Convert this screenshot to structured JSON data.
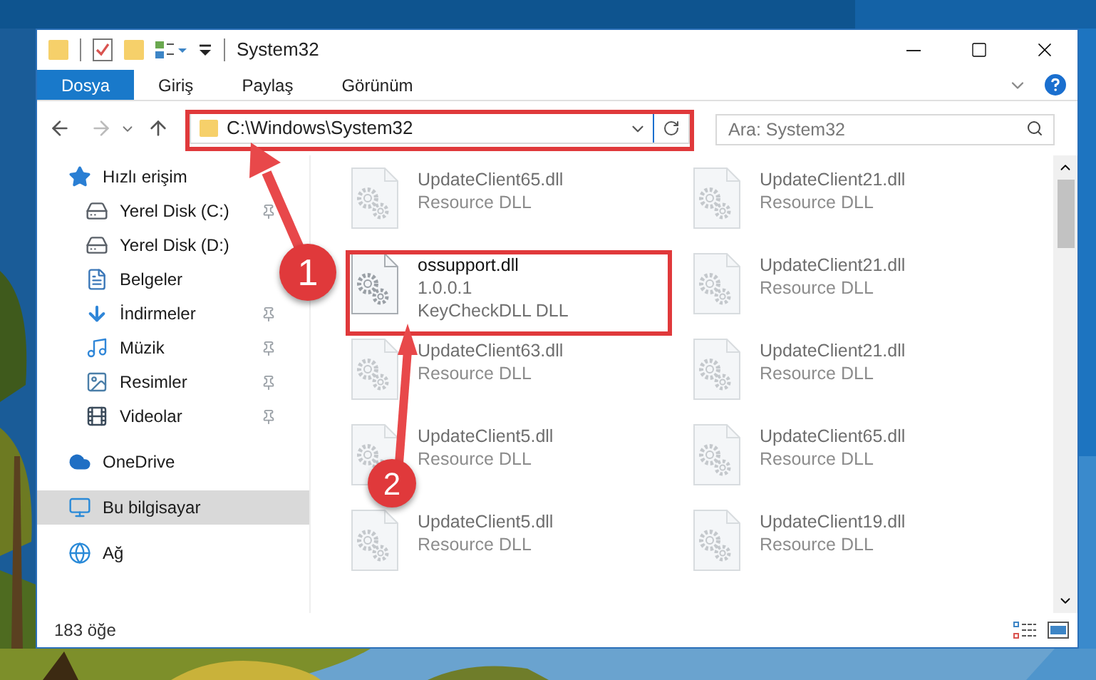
{
  "window": {
    "title": "System32"
  },
  "ribbon_tabs": [
    {
      "label": "Dosya",
      "kind": "file",
      "selected": false
    },
    {
      "label": "Giriş",
      "kind": "tab",
      "selected": false
    },
    {
      "label": "Paylaş",
      "kind": "tab",
      "selected": false
    },
    {
      "label": "Görünüm",
      "kind": "tab",
      "selected": false
    }
  ],
  "address_bar": {
    "path": "C:\\Windows\\System32"
  },
  "search": {
    "placeholder": "Ara: System32"
  },
  "sidebar": {
    "items": [
      {
        "label": "Hızlı erişim",
        "kind": "quick",
        "selected": false,
        "children": [
          {
            "label": "Yerel Disk (C:)",
            "kind": "drive-c",
            "pinned": true,
            "selected": false
          },
          {
            "label": "Yerel Disk (D:)",
            "kind": "drive",
            "pinned": false,
            "selected": false
          },
          {
            "label": "Belgeler",
            "kind": "documents",
            "pinned": false,
            "selected": false
          },
          {
            "label": "İndirmeler",
            "kind": "downloads",
            "pinned": true,
            "selected": false
          },
          {
            "label": "Müzik",
            "kind": "music",
            "pinned": true,
            "selected": false
          },
          {
            "label": "Resimler",
            "kind": "pictures",
            "pinned": true,
            "selected": false
          },
          {
            "label": "Videolar",
            "kind": "videos",
            "pinned": true,
            "selected": false
          }
        ]
      },
      {
        "label": "OneDrive",
        "kind": "cloud",
        "selected": false
      },
      {
        "label": "Bu bilgisayar",
        "kind": "pc",
        "selected": true
      },
      {
        "label": "Ağ",
        "kind": "network",
        "selected": false
      }
    ]
  },
  "files": [
    {
      "name": "UpdateClient65.dll",
      "details": [
        "Resource DLL"
      ],
      "faded": true
    },
    {
      "name": "UpdateClient21.dll",
      "details": [
        "Resource DLL"
      ],
      "faded": true
    },
    {
      "name": "ossupport.dll",
      "details": [
        "1.0.0.1",
        "KeyCheckDLL DLL"
      ],
      "faded": false
    },
    {
      "name": "UpdateClient21.dll",
      "details": [
        "Resource DLL"
      ],
      "faded": true
    },
    {
      "name": "UpdateClient63.dll",
      "details": [
        "Resource DLL"
      ],
      "faded": true
    },
    {
      "name": "UpdateClient21.dll",
      "details": [
        "Resource DLL"
      ],
      "faded": true
    },
    {
      "name": "UpdateClient5.dll",
      "details": [
        "Resource DLL"
      ],
      "faded": true
    },
    {
      "name": "UpdateClient65.dll",
      "details": [
        "Resource DLL"
      ],
      "faded": true
    },
    {
      "name": "UpdateClient5.dll",
      "details": [
        "Resource DLL"
      ],
      "faded": true
    },
    {
      "name": "UpdateClient19.dll",
      "details": [
        "Resource DLL"
      ],
      "faded": true
    }
  ],
  "status_bar": {
    "count": "183 öğe"
  },
  "annotations": [
    {
      "number": "1"
    },
    {
      "number": "2"
    }
  ]
}
